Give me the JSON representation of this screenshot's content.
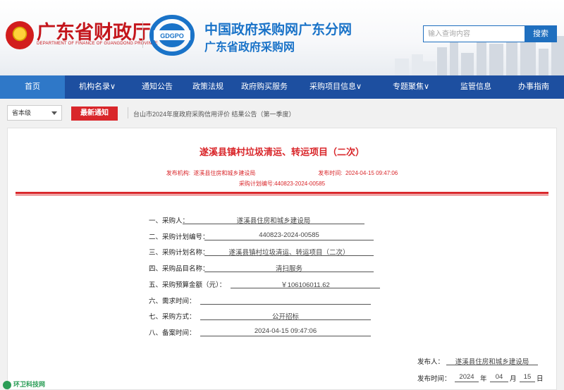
{
  "header": {
    "mof_title": "广东省财政厅",
    "mof_subtitle": "DEPARTMENT OF FINANCE OF GUANGDONG PROVINCE",
    "logo_text": "GDGPO",
    "gp_title": "中国政府采购网广东分网",
    "gp_subtitle": "广东省政府采购网",
    "search_placeholder": "输入查询内容",
    "search_button": "搜索"
  },
  "nav": {
    "items": [
      {
        "label": "首页",
        "active": true
      },
      {
        "label": "机构名录∨"
      },
      {
        "label": "通知公告"
      },
      {
        "label": "政策法规"
      },
      {
        "label": "政府购买服务"
      },
      {
        "label": "采购项目信息∨"
      },
      {
        "label": "专题聚焦∨"
      },
      {
        "label": "监管信息"
      },
      {
        "label": "办事指南"
      }
    ]
  },
  "ticker": {
    "region_select": "省本级",
    "tag": "最新通知",
    "text": "台山市2024年度政府采购信用评价 结果公告（第一季度）"
  },
  "document": {
    "title": "遂溪县镇村垃圾清运、转运项目（二次）",
    "meta_line1": "发布机构:  遂溪县住房和城乡建设局                                        发布时间:  2024-04-15 09:47:06",
    "meta_line2": "采购计划编号:440823-2024-00585",
    "fields": [
      {
        "label": "一、采购人：",
        "value": "遂溪县住房和城乡建设局"
      },
      {
        "label": "二、采购计划编号：",
        "value": "440823-2024-00585"
      },
      {
        "label": "三、采购计划名称：",
        "value": "遂溪县镇村垃圾清运、转运项目（二次）"
      },
      {
        "label": "四、采购品目名称：",
        "value": "清扫服务"
      },
      {
        "label": "五、采购预算金额（元）：",
        "value": "￥106106011.62"
      },
      {
        "label": "六、需求时间：",
        "value": ""
      },
      {
        "label": "七、采购方式：",
        "value": "公开招标"
      },
      {
        "label": "八、备案时间：",
        "value": "2024-04-15 09:47:06"
      }
    ],
    "publisher_label": "发布人：",
    "publisher_value": "遂溪县住房和城乡建设局",
    "pubtime_label": "发布时间：",
    "pub_year": "2024",
    "year_unit": "年",
    "pub_month": "04",
    "month_unit": "月",
    "pub_day": "15",
    "day_unit": "日"
  },
  "watermark": "环卫科技网",
  "colors": {
    "nav_bg": "#1d4fa0",
    "nav_active": "#2f78c8",
    "accent_red": "#d9262a",
    "brand_blue": "#1a73c8"
  }
}
